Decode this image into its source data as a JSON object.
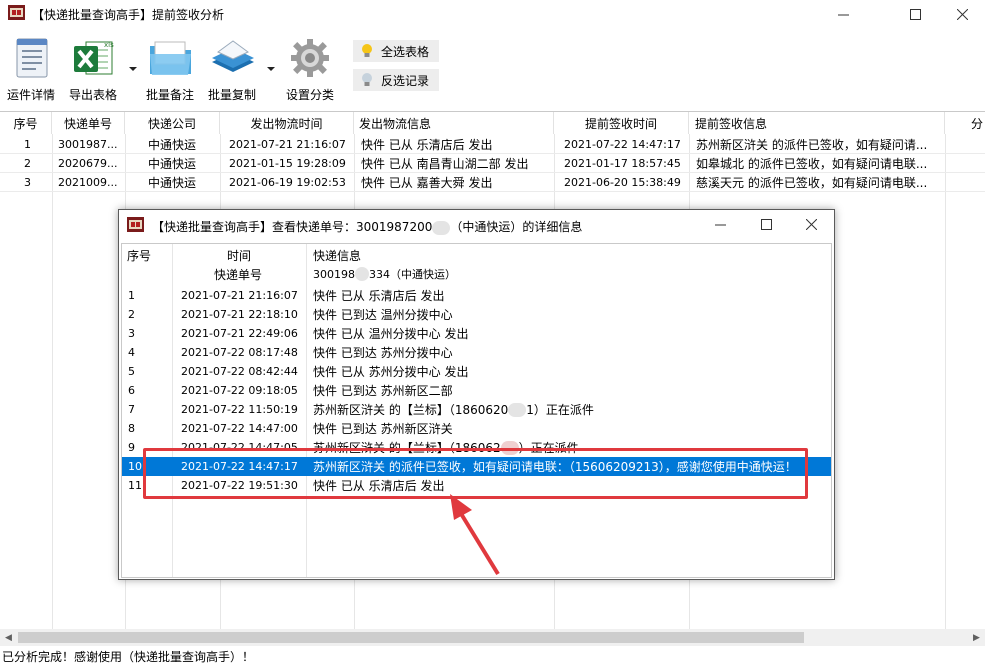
{
  "window": {
    "title": "【快递批量查询高手】提前签收分析",
    "controls": {
      "minimize": "—",
      "maximize": "☐",
      "close": "✕"
    }
  },
  "toolbar": {
    "buttons": [
      {
        "label": "运件详情",
        "icon": "document-icon"
      },
      {
        "label": "导出表格",
        "icon": "excel-icon"
      },
      {
        "label": "批量备注",
        "icon": "folder-icon"
      },
      {
        "label": "批量复制",
        "icon": "copy-stack-icon"
      },
      {
        "label": "设置分类",
        "icon": "gear-icon"
      }
    ],
    "select_all_label": "全选表格",
    "invert_label": "反选记录"
  },
  "grid": {
    "columns": [
      "序号",
      "快递单号",
      "快递公司",
      "发出物流时间",
      "发出物流信息",
      "提前签收时间",
      "提前签收信息",
      "分"
    ],
    "rows": [
      {
        "index": "1",
        "tracking": "3001987...",
        "company": "中通快运",
        "ship_time": "2021-07-21 21:16:07",
        "ship_info": "快件 已从 乐清店后 发出",
        "sign_time": "2021-07-22 14:47:17",
        "sign_info": "苏州新区浒关 的派件已签收，如有疑问请..."
      },
      {
        "index": "2",
        "tracking": "2020679...",
        "company": "中通快运",
        "ship_time": "2021-01-15 19:28:09",
        "ship_info": "快件 已从 南昌青山湖二部 发出",
        "sign_time": "2021-01-17 18:57:45",
        "sign_info": "如皋城北 的派件已签收，如有疑问请电联..."
      },
      {
        "index": "3",
        "tracking": "2021009...",
        "company": "中通快运",
        "ship_time": "2021-06-19 19:02:53",
        "ship_info": "快件 已从 嘉善大舜 发出",
        "sign_time": "2021-06-20 15:38:49",
        "sign_info": "慈溪天元 的派件已签收，如有疑问请电联..."
      }
    ]
  },
  "status": "已分析完成！感谢使用（快递批量查询高手）！",
  "dialog": {
    "title_prefix": "【快递批量查询高手】查看快递单号：3001987200",
    "title_suffix": "（中通快运）的详细信息",
    "controls": {
      "minimize": "—",
      "maximize": "☐",
      "close": "✕"
    },
    "headers": {
      "index": "序号",
      "time": "时间",
      "info": "快递信息"
    },
    "tracking_label": "快递单号",
    "tracking_value_prefix": "300198",
    "tracking_value_suffix": "334（中通快运）",
    "rows": [
      {
        "index": "1",
        "time": "2021-07-21 21:16:07",
        "info": "快件 已从 乐清店后 发出"
      },
      {
        "index": "2",
        "time": "2021-07-21 22:18:10",
        "info": "快件 已到达 温州分拨中心"
      },
      {
        "index": "3",
        "time": "2021-07-21 22:49:06",
        "info": "快件 已从 温州分拨中心 发出"
      },
      {
        "index": "4",
        "time": "2021-07-22 08:17:48",
        "info": "快件 已到达 苏州分拨中心"
      },
      {
        "index": "5",
        "time": "2021-07-22 08:42:44",
        "info": "快件 已从 苏州分拨中心 发出"
      },
      {
        "index": "6",
        "time": "2021-07-22 09:18:05",
        "info": "快件 已到达 苏州新区二部"
      },
      {
        "index": "7",
        "time": "2021-07-22 11:50:19",
        "info_prefix": "苏州新区浒关 的【兰标】（1860620",
        "info_suffix": "1）正在派件"
      },
      {
        "index": "8",
        "time": "2021-07-22 14:47:00",
        "info": "快件 已到达 苏州新区浒关"
      },
      {
        "index": "9",
        "time": "2021-07-22 14:47:05",
        "info_prefix": "苏州新区浒关 的【兰标】（186062",
        "info_suffix": "）正在派件"
      },
      {
        "index": "10",
        "time": "2021-07-22 14:47:17",
        "info": "苏州新区浒关 的派件已签收，如有疑问请电联：（15606209213），感谢您使用中通快运！"
      },
      {
        "index": "11",
        "time": "2021-07-22 19:51:30",
        "info": "快件 已从 乐清店后 发出"
      }
    ],
    "selected_index": "10"
  },
  "colors": {
    "selection": "#0078d7",
    "highlight_box": "#e0393e"
  }
}
